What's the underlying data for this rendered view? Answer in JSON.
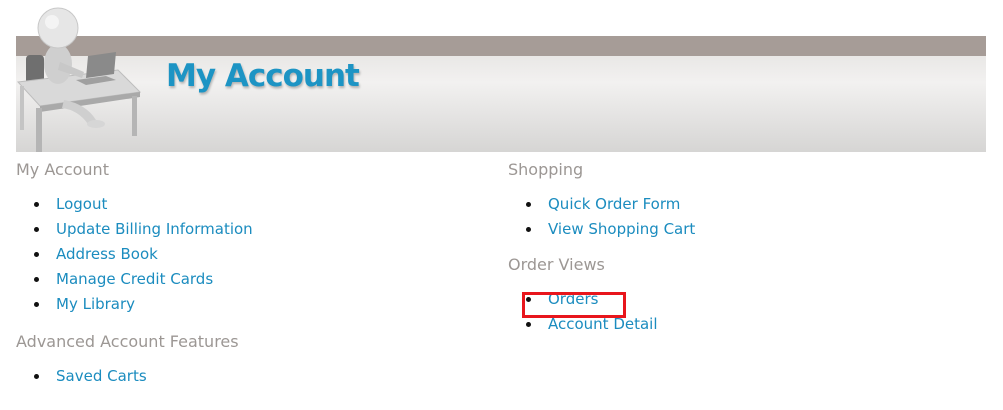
{
  "banner": {
    "title": "My Account"
  },
  "sections": {
    "my_account": {
      "heading": "My Account",
      "items": [
        "Logout",
        "Update Billing Information",
        "Address Book",
        "Manage Credit Cards",
        "My Library"
      ]
    },
    "advanced": {
      "heading": "Advanced Account Features",
      "items": [
        "Saved Carts"
      ]
    },
    "shopping": {
      "heading": "Shopping",
      "items": [
        "Quick Order Form",
        "View Shopping Cart"
      ]
    },
    "order_views": {
      "heading": "Order Views",
      "items": [
        "Orders",
        "Account Detail"
      ]
    }
  },
  "highlight": {
    "target": "Orders",
    "color": "#e8161c"
  },
  "colors": {
    "link": "#1b8cbf",
    "heading": "#9c9794",
    "title": "#1d94c4",
    "stripe": "#a69c97"
  }
}
